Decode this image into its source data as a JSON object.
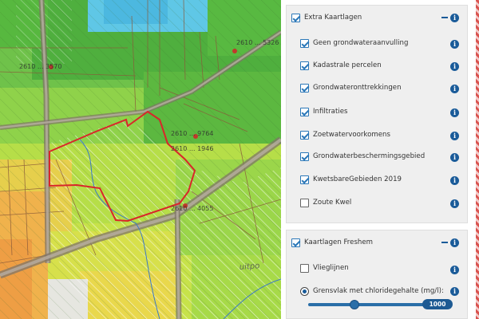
{
  "map": {
    "parcel_labels": [
      "2610 ... 3570",
      "2610 ... 5326",
      "2610 ... 9764",
      "2610 ... 1946",
      "2610 ... 4055"
    ],
    "place_label": "uitpo",
    "colors": {
      "blue_zone": "#5ec4e8",
      "green_dark": "#4fb33c",
      "green_mid": "#7ccc4a",
      "yellow_green": "#c9e44a",
      "yellow": "#eed24c",
      "orange": "#f0b04c",
      "road": "#8a7f74",
      "parcel_line": "#8a5a3a",
      "selection": "#d9262a",
      "hatch": "#ffffff"
    }
  },
  "panel_extra": {
    "title": "Extra Kaartlagen",
    "checked": true,
    "collapse_icon": "minus-icon",
    "layers": [
      {
        "label": "Geen grondwateraanvulling",
        "checked": true
      },
      {
        "label": "Kadastrale percelen",
        "checked": true
      },
      {
        "label": "Grondwateronttrekkingen",
        "checked": true
      },
      {
        "label": "Infiltraties",
        "checked": true
      },
      {
        "label": "Zoetwatervoorkomens",
        "checked": true
      },
      {
        "label": "Grondwaterbeschermingsgebied",
        "checked": true
      },
      {
        "label": "KwetsbareGebieden 2019",
        "checked": true
      },
      {
        "label": "Zoute Kwel",
        "checked": false
      }
    ]
  },
  "panel_freshem": {
    "title": "Kaartlagen Freshem",
    "checked": true,
    "layers": [
      {
        "label": "Vlieglijnen",
        "checked": false
      },
      {
        "label": "Grensvlak met chloridegehalte (mg/l):",
        "radio": true
      }
    ],
    "slider_value": "1000",
    "slider_fraction": 0.38
  },
  "info_icon": "i"
}
